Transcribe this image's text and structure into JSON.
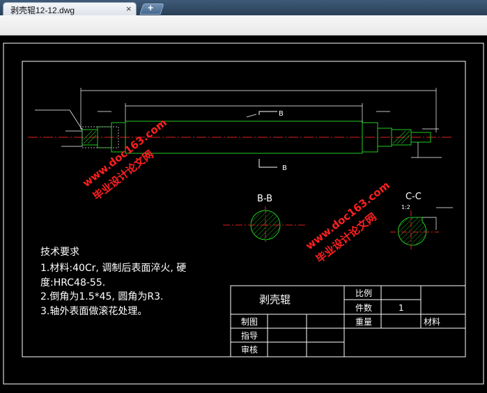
{
  "tab": {
    "title": "剥壳辊12-12.dwg",
    "close_glyph": "×",
    "new_tab_glyph": "+"
  },
  "drawing": {
    "section_bb": "B-B",
    "section_cc": "C-C",
    "cc_scale": "1:2",
    "cut_label_top": "B",
    "cut_label_bottom": "B",
    "tech_req": {
      "heading": "技术要求",
      "line1": "1.材料:40Cr, 调制后表面淬火, 硬",
      "line2": "度:HRC48-55.",
      "line3": "2.倒角为1.5*45, 圆角为R3.",
      "line4": "3.轴外表面做滚花处理。"
    },
    "title_block": {
      "part_name": "剥壳辊",
      "scale_label": "比例",
      "qty_label": "件数",
      "qty_value": "1",
      "weight_label": "重量",
      "material_label": "材料",
      "drawn_label": "制图",
      "guide_label": "指导",
      "review_label": "审核"
    },
    "watermark": {
      "url": "www.doc163.com",
      "text": "毕业设计论文网"
    }
  }
}
